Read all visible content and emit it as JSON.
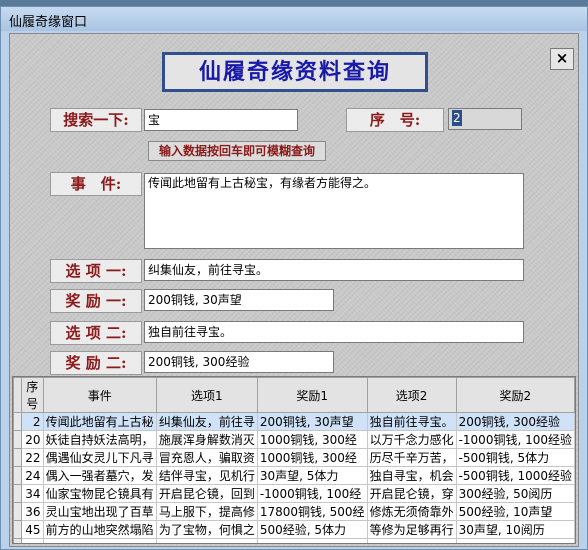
{
  "window": {
    "title": "仙履奇缘窗口",
    "close_glyph": "×"
  },
  "main_title": "仙履奇缘资料查询",
  "search": {
    "label": "搜索一下:",
    "value": "宝"
  },
  "seq": {
    "label": "序　号:",
    "value": "2"
  },
  "hint_button": "输入数据按回车即可模糊查询",
  "event": {
    "label": "事　件:",
    "value": "传闻此地留有上古秘宝，有缘者方能得之。"
  },
  "option1": {
    "label": "选 项 一:",
    "value": "纠集仙友，前往寻宝。"
  },
  "reward1": {
    "label": "奖 励 一:",
    "value": "200铜钱, 30声望"
  },
  "option2": {
    "label": "选 项 二:",
    "value": "独自前往寻宝。"
  },
  "reward2": {
    "label": "奖 励 二:",
    "value": "200铜钱, 300经验"
  },
  "table": {
    "headers": [
      "序号",
      "事件",
      "选项1",
      "奖励1",
      "选项2",
      "奖励2"
    ],
    "rows": [
      [
        "2",
        "传闻此地留有上古秘",
        "纠集仙友，前往寻",
        "200铜钱, 30声望",
        "独自前往寻宝。",
        "200铜钱, 300经验"
      ],
      [
        "20",
        "妖徒自持妖法高明，",
        "施展浑身解数消灭",
        "1000铜钱, 300经",
        "以万千念力感化",
        "-1000铜钱, 100经验"
      ],
      [
        "22",
        "偶遇仙女灵儿下凡寻",
        "冒充恩人，骗取资",
        "1000铜钱, 300经",
        "历尽千辛万苦，",
        "-500铜钱, 5体力"
      ],
      [
        "24",
        "偶入一强者墓穴，发",
        "结伴寻宝，见机行",
        "30声望, 5体力",
        "独自寻宝，机会",
        "-500铜钱, 1000经验"
      ],
      [
        "34",
        "仙家宝物昆仑镜具有",
        "开启昆仑镜，回到",
        "-1000铜钱, 100经",
        "开启昆仑镜，穿",
        "300经验, 50阅历"
      ],
      [
        "36",
        "灵山宝地出现了百草",
        "马上服下，提高修",
        "17800铜钱, 500经",
        "修炼无须倚靠外",
        "500经验, 10声望"
      ],
      [
        "45",
        "前方的山地突然塌陷",
        "为了宝物，何惧之",
        "500经验, 5体力",
        "等修为足够再行",
        "30声望, 10阅历"
      ]
    ],
    "new_row_marker": "*"
  }
}
